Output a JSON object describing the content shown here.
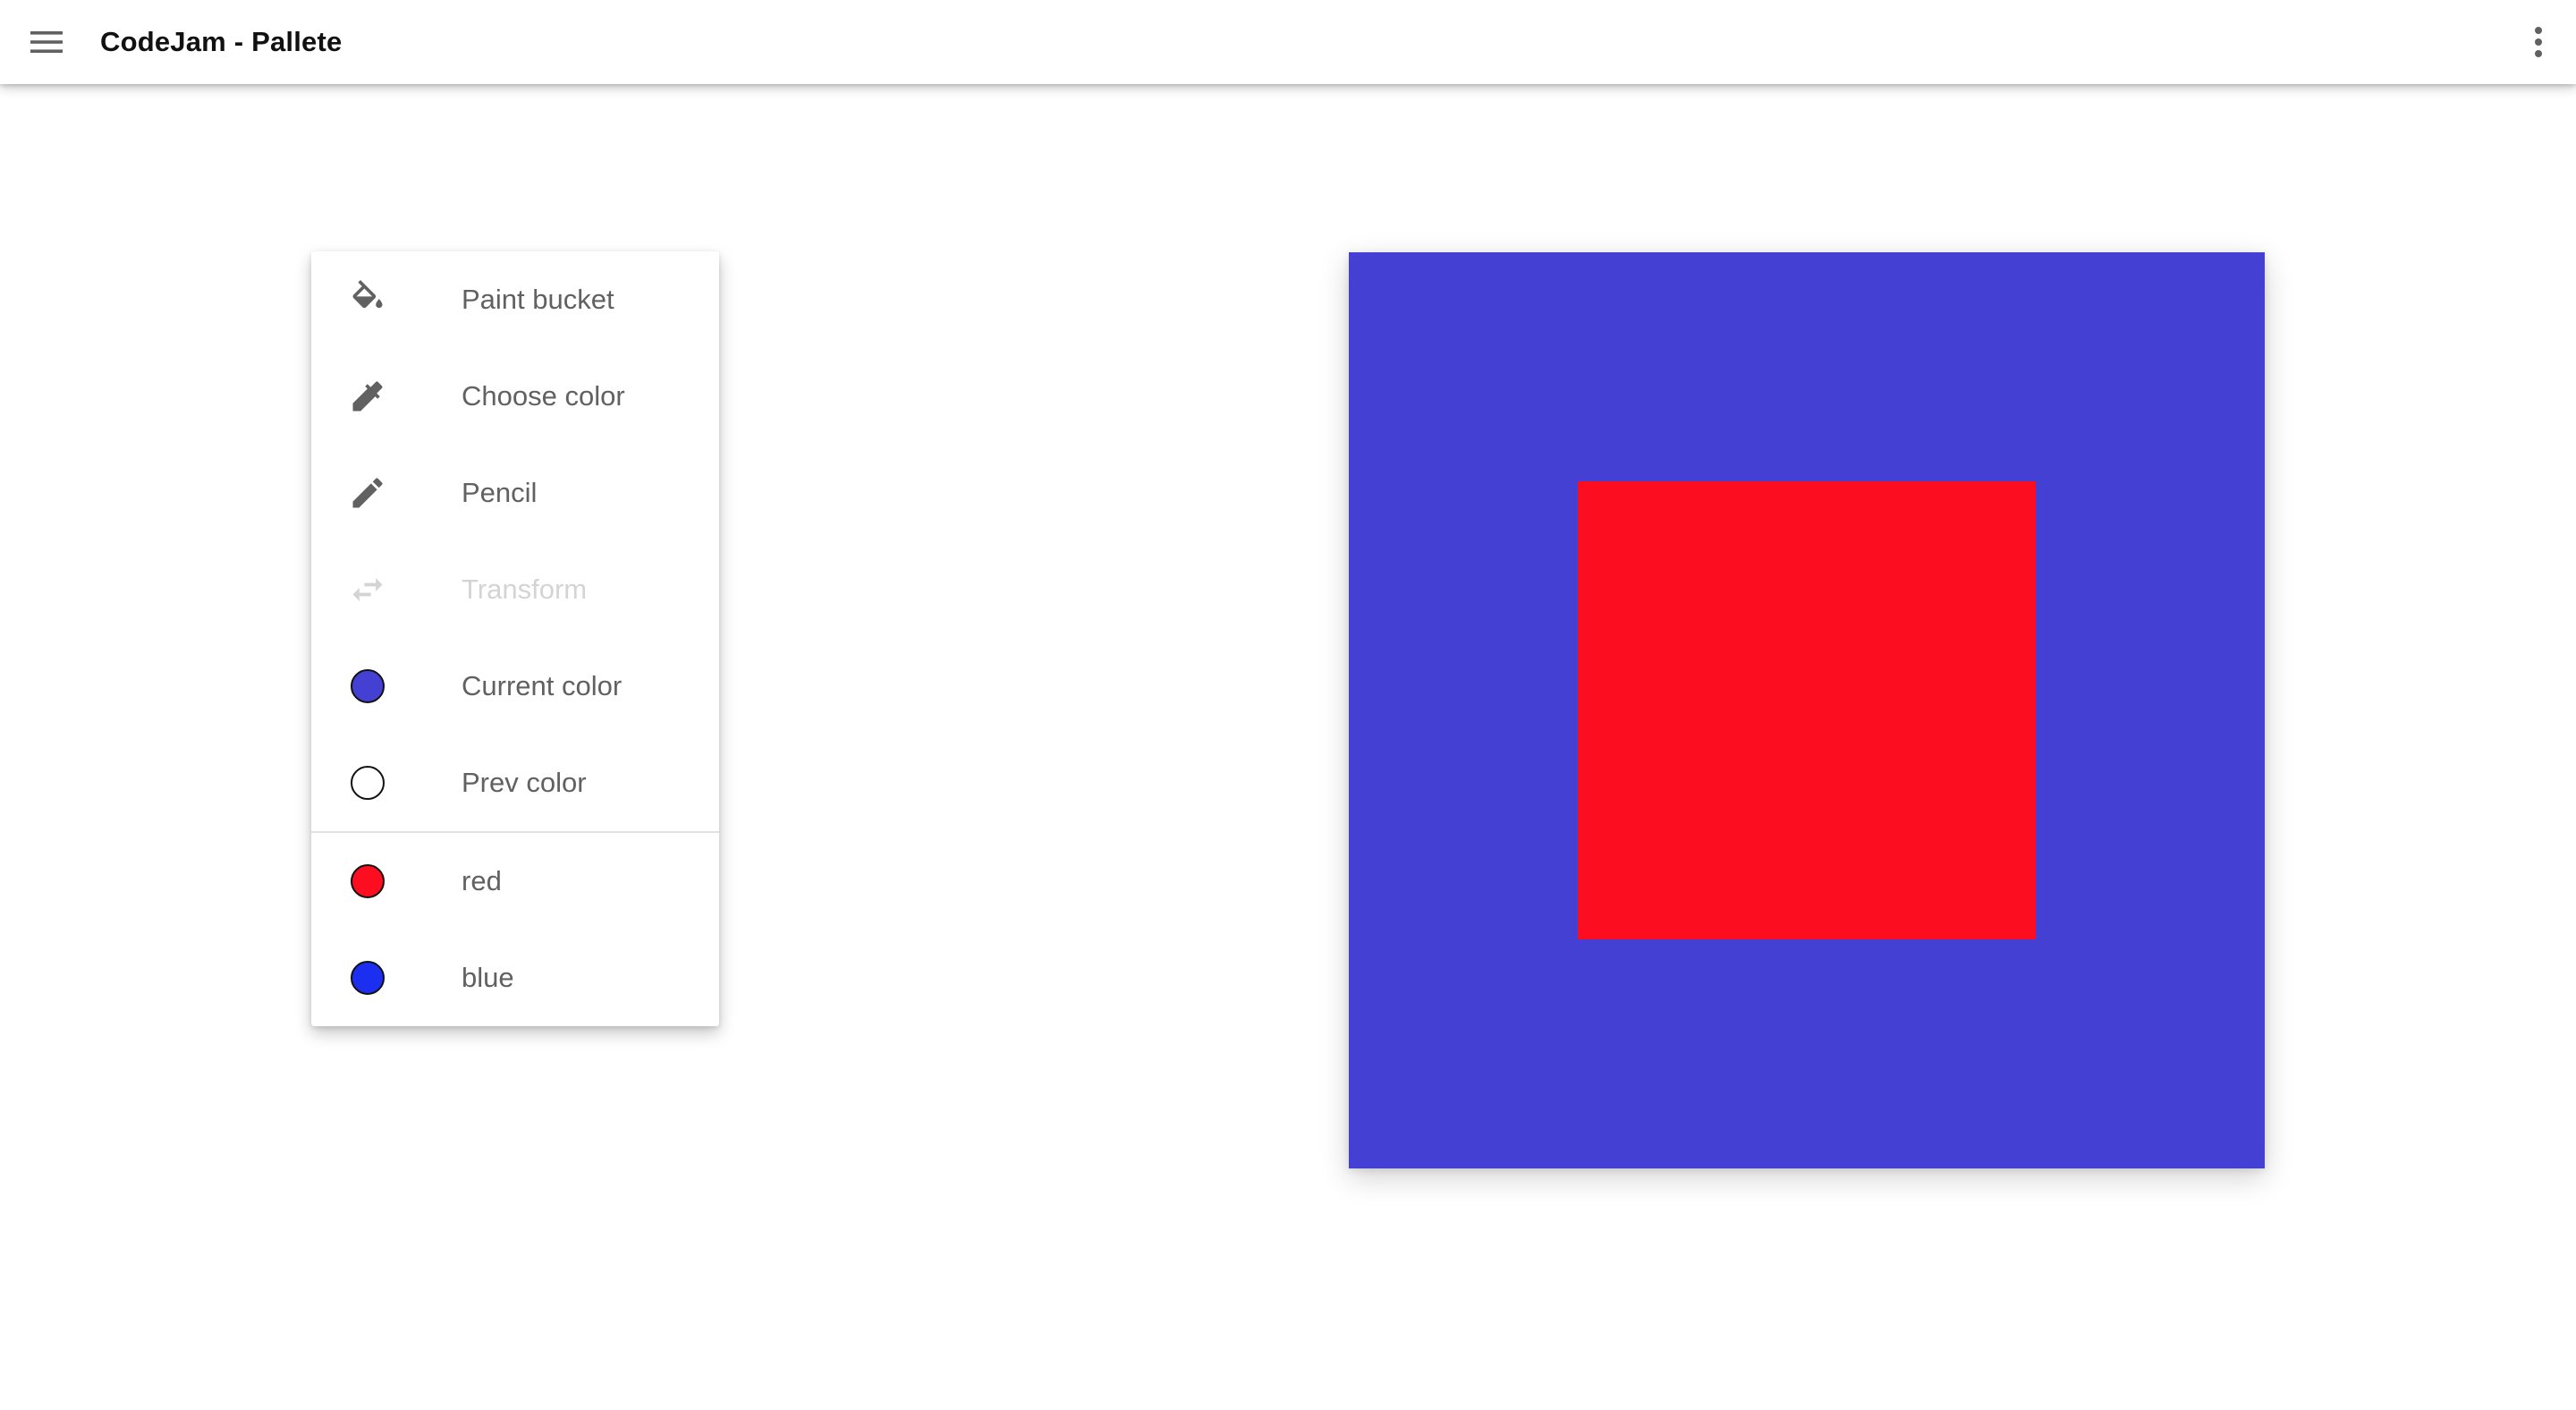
{
  "app": {
    "title": "CodeJam - Pallete"
  },
  "icons": {
    "menu": "hamburger-menu-icon",
    "more": "more-vertical-icon"
  },
  "tools": [
    {
      "label": "Paint bucket",
      "icon": "paint-bucket-icon",
      "disabled": false
    },
    {
      "label": "Choose color",
      "icon": "eyedropper-icon",
      "disabled": false
    },
    {
      "label": "Pencil",
      "icon": "pencil-icon",
      "disabled": false
    },
    {
      "label": "Transform",
      "icon": "swap-arrows-icon",
      "disabled": true
    }
  ],
  "colors": {
    "current": {
      "label": "Current color",
      "color": "#4440d3"
    },
    "previous": {
      "label": "Prev color",
      "color": "#ffffff"
    }
  },
  "swatches": [
    {
      "label": "red",
      "color": "#fc0d1f"
    },
    {
      "label": "blue",
      "color": "#1c2ff0"
    }
  ],
  "canvas": {
    "background_color": "#4440d3",
    "shape_color": "#fc0d1f"
  }
}
